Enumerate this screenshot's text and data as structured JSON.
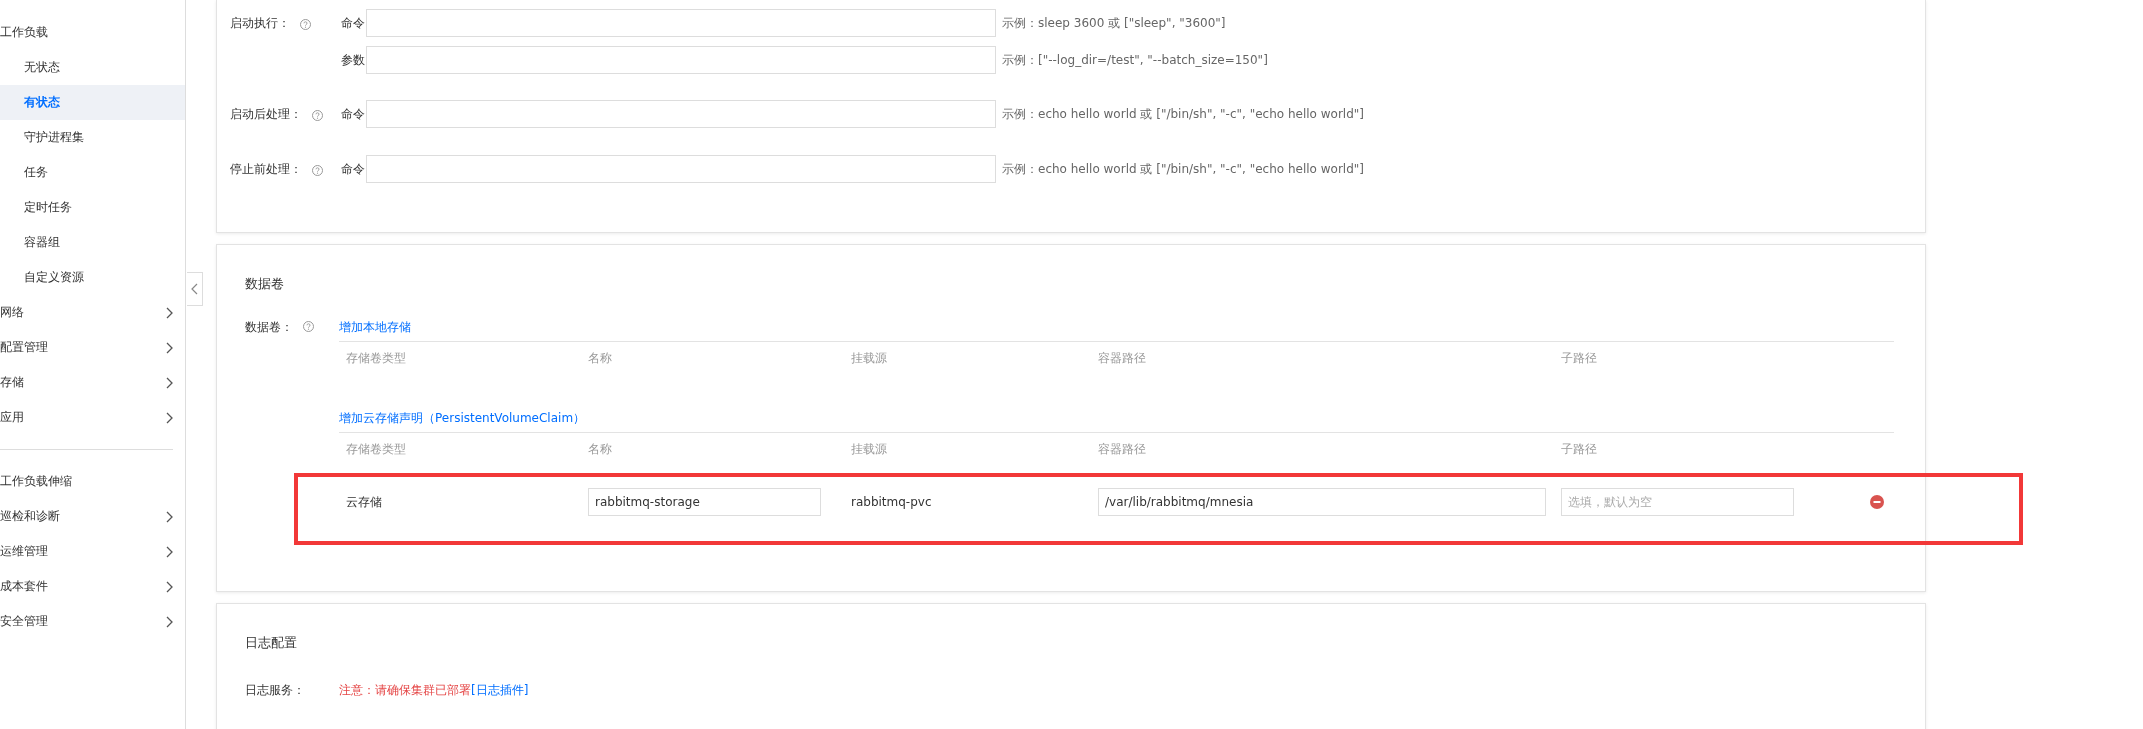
{
  "sidebar": {
    "sections": [
      {
        "items": [
          {
            "label": "工作负载",
            "selected": false,
            "has_submenu": false,
            "children": [
              {
                "label": "无状态",
                "selected": false
              },
              {
                "label": "有状态",
                "selected": true
              },
              {
                "label": "守护进程集",
                "selected": false
              },
              {
                "label": "任务",
                "selected": false
              },
              {
                "label": "定时任务",
                "selected": false
              },
              {
                "label": "容器组",
                "selected": false
              },
              {
                "label": "自定义资源",
                "selected": false
              }
            ]
          },
          {
            "label": "网络",
            "selected": false,
            "has_submenu": true
          },
          {
            "label": "配置管理",
            "selected": false,
            "has_submenu": true
          },
          {
            "label": "存储",
            "selected": false,
            "has_submenu": true
          },
          {
            "label": "应用",
            "selected": false,
            "has_submenu": true
          }
        ]
      },
      {
        "items": [
          {
            "label": "工作负载伸缩",
            "selected": false,
            "has_submenu": false
          },
          {
            "label": "巡检和诊断",
            "selected": false,
            "has_submenu": true
          },
          {
            "label": "运维管理",
            "selected": false,
            "has_submenu": true
          },
          {
            "label": "成本套件",
            "selected": false,
            "has_submenu": true
          },
          {
            "label": "安全管理",
            "selected": false,
            "has_submenu": true
          }
        ]
      }
    ]
  },
  "lifecycle": {
    "rows": [
      {
        "label": "启动执行：",
        "sublabel": "命令",
        "hint": "示例：sleep 3600 或 [\"sleep\", \"3600\"]"
      },
      {
        "sublabel": "参数",
        "hint": "示例：[\"--log_dir=/test\", \"--batch_size=150\"]"
      },
      {
        "label": "启动后处理：",
        "sublabel": "命令",
        "hint": "示例：echo hello world 或 [\"/bin/sh\", \"-c\", \"echo hello world\"]"
      },
      {
        "label": "停止前处理：",
        "sublabel": "命令",
        "hint": "示例：echo hello world 或 [\"/bin/sh\", \"-c\", \"echo hello world\"]"
      }
    ]
  },
  "volumes": {
    "title": "数据卷",
    "label": "数据卷：",
    "groups": [
      {
        "link": "增加本地存储",
        "columns": [
          "存储卷类型",
          "名称",
          "挂载源",
          "容器路径",
          "子路径"
        ]
      },
      {
        "link": "增加云存储声明（PersistentVolumeClaim）",
        "columns": [
          "存储卷类型",
          "名称",
          "挂载源",
          "容器路径",
          "子路径"
        ],
        "rows": [
          {
            "type": "云存储",
            "name": "rabbitmq-storage",
            "source": "rabbitmq-pvc",
            "path": "/var/lib/rabbitmq/mnesia",
            "subpath_placeholder": "选填，默认为空",
            "highlighted": true
          }
        ]
      }
    ]
  },
  "logs": {
    "title": "日志配置",
    "label": "日志服务：",
    "notice": "注意：请确保集群已部署",
    "notice_link": "[日志插件]"
  }
}
